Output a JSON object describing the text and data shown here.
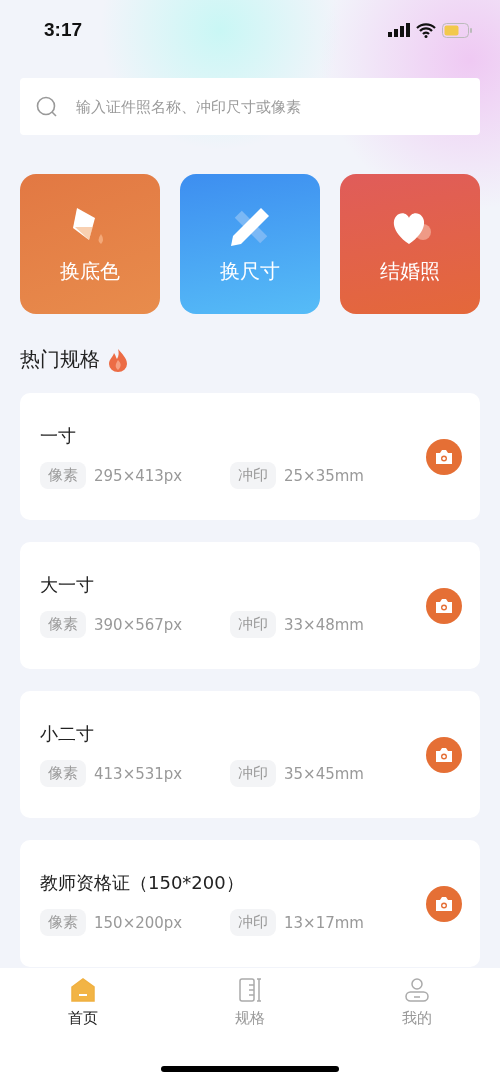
{
  "status_bar": {
    "time": "3:17"
  },
  "search": {
    "placeholder": "输入证件照名称、冲印尺寸或像素"
  },
  "tools": [
    {
      "label": "换底色",
      "kind": "bucket"
    },
    {
      "label": "换尺寸",
      "kind": "pencil"
    },
    {
      "label": "结婚照",
      "kind": "heart"
    }
  ],
  "section_title": "热门规格",
  "specs": [
    {
      "name": "一寸",
      "pixel_label": "像素",
      "pixels": "295×413px",
      "print_label": "冲印",
      "print": "25×35mm"
    },
    {
      "name": "大一寸",
      "pixel_label": "像素",
      "pixels": "390×567px",
      "print_label": "冲印",
      "print": "33×48mm"
    },
    {
      "name": "小二寸",
      "pixel_label": "像素",
      "pixels": "413×531px",
      "print_label": "冲印",
      "print": "35×45mm"
    },
    {
      "name": "教师资格证（150*200）",
      "pixel_label": "像素",
      "pixels": "150×200px",
      "print_label": "冲印",
      "print": "13×17mm"
    }
  ],
  "tab_bar": [
    {
      "label": "首页",
      "kind": "home",
      "selected": true
    },
    {
      "label": "规格",
      "kind": "ruler",
      "selected": false
    },
    {
      "label": "我的",
      "kind": "user",
      "selected": false
    }
  ]
}
